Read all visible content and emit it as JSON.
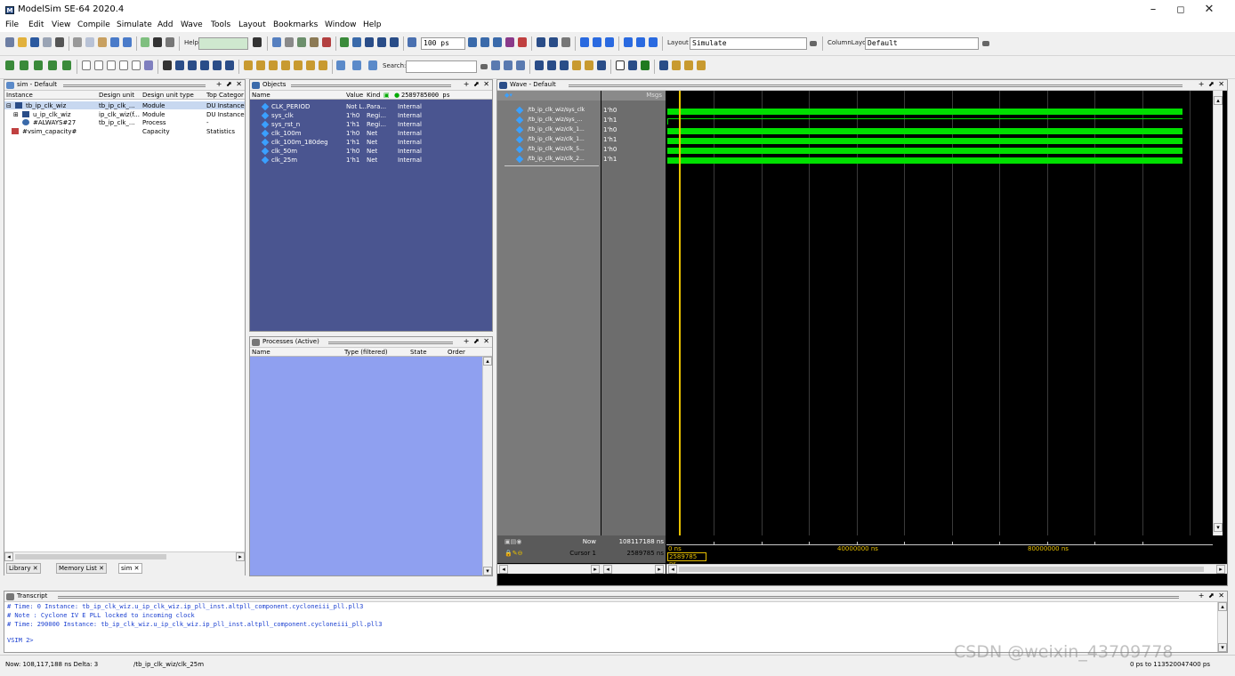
{
  "window": {
    "title": "ModelSim SE-64 2020.4",
    "logo": "M",
    "controls": [
      "–",
      "◻",
      "✕"
    ]
  },
  "menu": [
    "File",
    "Edit",
    "View",
    "Compile",
    "Simulate",
    "Add",
    "Wave",
    "Tools",
    "Layout",
    "Bookmarks",
    "Window",
    "Help"
  ],
  "toolbar": {
    "help_label": "Help",
    "run_length": "100 ps",
    "layout_label": "Layout",
    "layout_value": "Simulate",
    "column_layout_label": "ColumnLayout",
    "column_layout_value": "Default",
    "search_label": "Search:"
  },
  "sim_panel": {
    "title": "sim - Default",
    "columns": [
      "Instance",
      "Design unit",
      "Design unit type",
      "Top Categor"
    ],
    "rows": [
      {
        "instance": "tb_ip_clk_wiz",
        "unit": "tb_ip_clk_...",
        "type": "Module",
        "cat": "DU Instance"
      },
      {
        "instance": "u_ip_clk_wiz",
        "unit": "ip_clk_wiz(f...",
        "type": "Module",
        "cat": "DU Instance"
      },
      {
        "instance": "#ALWAYS#27",
        "unit": "tb_ip_clk_...",
        "type": "Process",
        "cat": "-"
      },
      {
        "instance": "#vsim_capacity#",
        "unit": "",
        "type": "Capacity",
        "cat": "Statistics"
      }
    ],
    "tabs": [
      "Library",
      "Memory List",
      "sim"
    ]
  },
  "objects_panel": {
    "title": "Objects",
    "columns": [
      "Name",
      "Value",
      "Kind"
    ],
    "now_value": "2589785000 ps",
    "rows": [
      {
        "name": "CLK_PERIOD",
        "value": "Not L...",
        "kind": "Para...",
        "mode": "Internal"
      },
      {
        "name": "sys_clk",
        "value": "1'h0",
        "kind": "Regi...",
        "mode": "Internal"
      },
      {
        "name": "sys_rst_n",
        "value": "1'h1",
        "kind": "Regi...",
        "mode": "Internal"
      },
      {
        "name": "clk_100m",
        "value": "1'h0",
        "kind": "Net",
        "mode": "Internal"
      },
      {
        "name": "clk_100m_180deg",
        "value": "1'h1",
        "kind": "Net",
        "mode": "Internal"
      },
      {
        "name": "clk_50m",
        "value": "1'h0",
        "kind": "Net",
        "mode": "Internal"
      },
      {
        "name": "clk_25m",
        "value": "1'h1",
        "kind": "Net",
        "mode": "Internal"
      }
    ]
  },
  "processes_panel": {
    "title": "Processes (Active)",
    "columns": [
      "Name",
      "Type (filtered)",
      "State",
      "Order"
    ]
  },
  "wave_panel": {
    "title": "Wave - Default",
    "msgs_label": "Msgs",
    "signals": [
      {
        "name": "/tb_ip_clk_wiz/sys_clk",
        "value": "1'h0"
      },
      {
        "name": "/tb_ip_clk_wiz/sys_...",
        "value": "1'h1"
      },
      {
        "name": "/tb_ip_clk_wiz/clk_1...",
        "value": "1'h0"
      },
      {
        "name": "/tb_ip_clk_wiz/clk_1...",
        "value": "1'h1"
      },
      {
        "name": "/tb_ip_clk_wiz/clk_5...",
        "value": "1'h0"
      },
      {
        "name": "/tb_ip_clk_wiz/clk_2...",
        "value": "1'h1"
      }
    ],
    "now_label": "Now",
    "now_value": "108117188 ns",
    "cursor_label": "Cursor 1",
    "cursor_value": "2589785 ns",
    "time_start": "0 ns",
    "time_mid": "40000000 ns",
    "time_end": "80000000 ns",
    "cursor_readout": "2589785 ns",
    "colors": {
      "wave": "#00e000",
      "cursor": "#e8c000",
      "background": "#000000"
    }
  },
  "transcript": {
    "title": "Transcript",
    "lines": [
      "# Time: 0  Instance: tb_ip_clk_wiz.u_ip_clk_wiz.ip_pll_inst.altpll_component.cycloneiii_pll.pll3",
      "#  Note : Cyclone IV E PLL locked to incoming clock",
      "# Time: 290000  Instance: tb_ip_clk_wiz.u_ip_clk_wiz.ip_pll_inst.altpll_component.cycloneiii_pll.pll3"
    ],
    "prompt": "VSIM 2>"
  },
  "statusbar": {
    "now": "Now: 108,117,188 ns  Delta: 3",
    "path": "/tb_ip_clk_wiz/clk_25m",
    "range": "0 ps to 113520047400 ps"
  },
  "watermark": "CSDN @weixin_43709778"
}
